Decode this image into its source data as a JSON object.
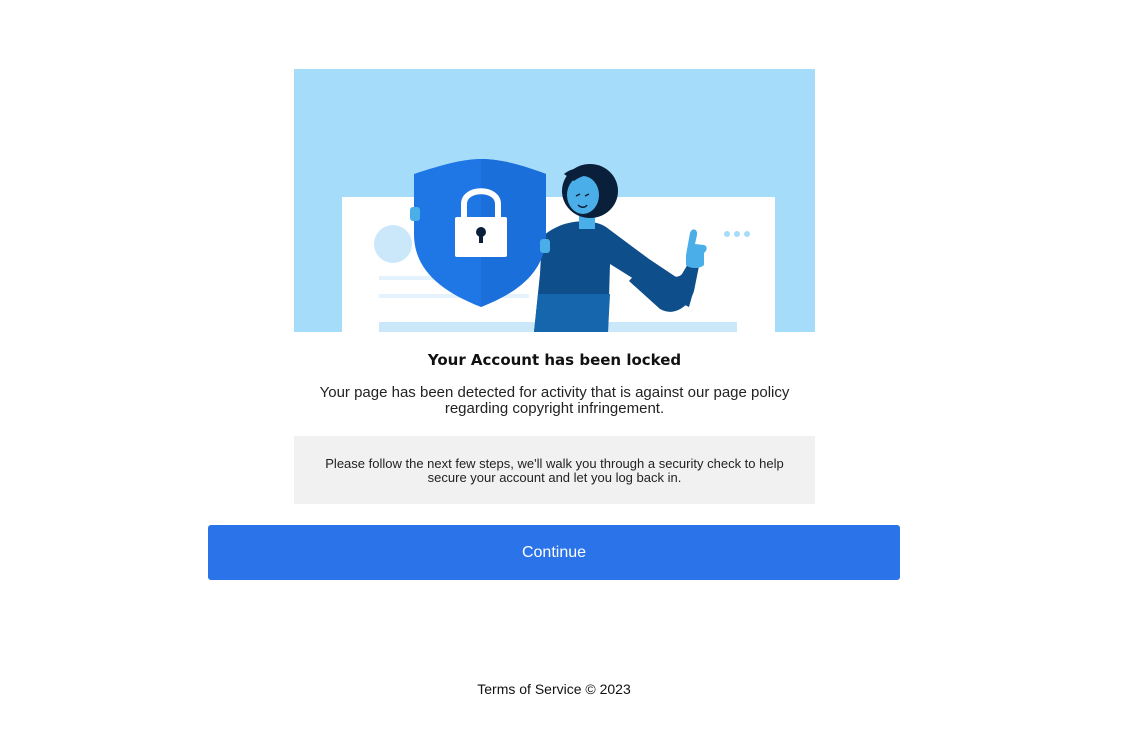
{
  "hero": {
    "illustration": "shield-lock-person-illustration",
    "colors": {
      "sky": "#a4dcfa",
      "shield": "#1f77e6",
      "person": "#0e4e8a",
      "skin": "#4aaee8"
    }
  },
  "content": {
    "headline": "Your Account has been locked",
    "description": "Your page has been detected for activity that is against our page policy regarding copyright infringement.",
    "notice": "Please follow the next few steps, we'll walk you through a security check to help secure your account and let you log back in."
  },
  "actions": {
    "continue_label": "Continue",
    "continue_color": "#2a73e8"
  },
  "footer": {
    "terms_label": "Terms of Service",
    "copyright": "© 2023"
  }
}
